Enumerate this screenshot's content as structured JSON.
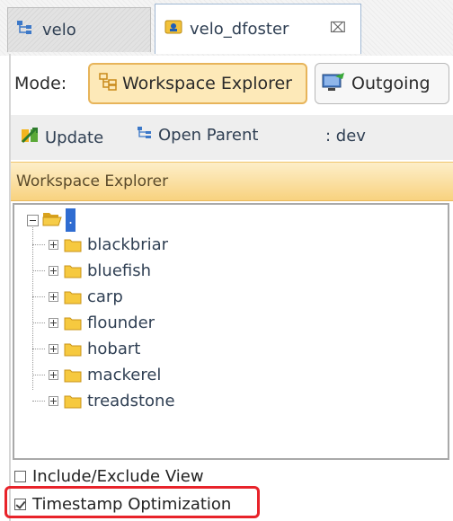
{
  "tabs": [
    {
      "label": "velo",
      "icon": "repository-tree-icon",
      "active": false
    },
    {
      "label": "velo_dfoster",
      "icon": "workspace-icon",
      "active": true,
      "close": "⌧"
    }
  ],
  "mode": {
    "label": "Mode:",
    "buttons": [
      {
        "label": "Workspace Explorer",
        "icon": "workspace-explorer-icon",
        "selected": true
      },
      {
        "label": "Outgoing",
        "icon": "outgoing-icon",
        "selected": false
      }
    ]
  },
  "toolbar": {
    "update_label": "Update",
    "open_parent_label": "Open Parent",
    "branch": ": dev"
  },
  "section": {
    "title": "Workspace Explorer"
  },
  "tree": {
    "root_label": ".",
    "items": [
      {
        "label": "blackbriar"
      },
      {
        "label": "bluefish"
      },
      {
        "label": "carp"
      },
      {
        "label": "flounder"
      },
      {
        "label": "hobart"
      },
      {
        "label": "mackerel"
      },
      {
        "label": "treadstone"
      }
    ]
  },
  "options": {
    "include_exclude_label": "Include/Exclude View",
    "include_exclude_checked": false,
    "timestamp_label": "Timestamp Optimization",
    "timestamp_checked": true
  },
  "colors": {
    "accent_header": "#f8d27f",
    "selected_mode": "#fde9b8",
    "selection_blue": "#2f6cd1",
    "highlight_red": "#e8232a",
    "folder_yellow": "#f2c23b"
  }
}
